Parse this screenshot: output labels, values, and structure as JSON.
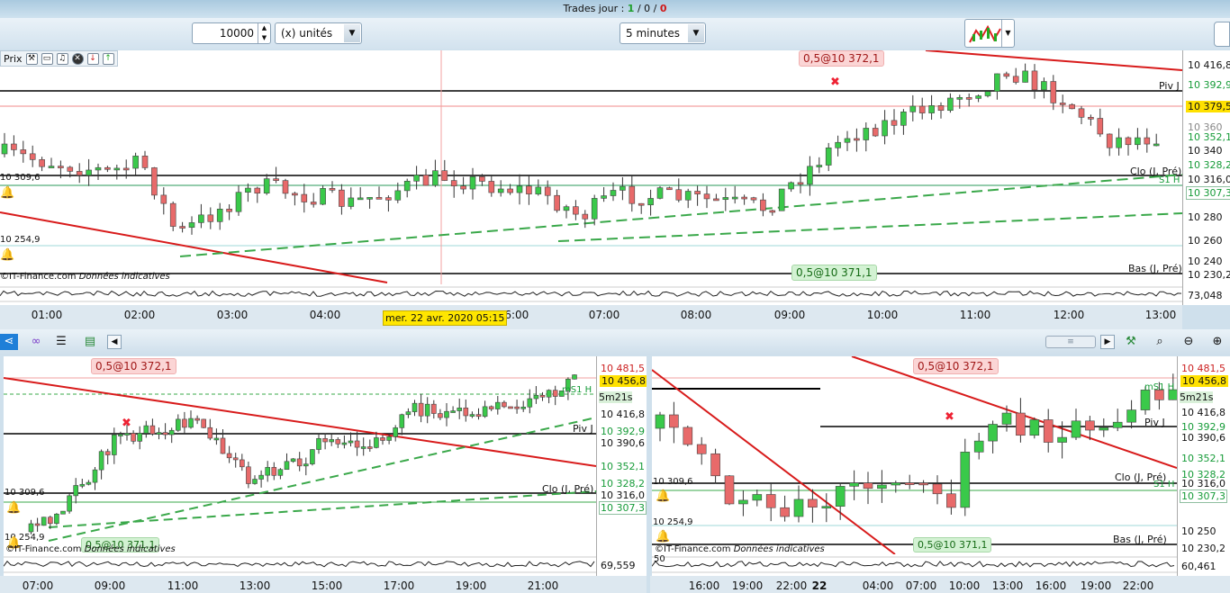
{
  "topbar": {
    "label": "Trades jour : ",
    "won": "1",
    "sep1": " / ",
    "neutral": "0",
    "sep2": " / ",
    "lost": "0"
  },
  "controls": {
    "quantity": "10000",
    "unit_select": "(x) unités",
    "period_select": "5 minutes"
  },
  "main_chart": {
    "legend": "Prix",
    "price_levels": [
      {
        "v": "10 416,8"
      },
      {
        "v": "10 392,9"
      },
      {
        "v": "10 379,5"
      },
      {
        "v": "10 360"
      },
      {
        "v": "10 352,1"
      },
      {
        "v": "10 340"
      },
      {
        "v": "10 328,2"
      },
      {
        "v": "10 316,0"
      },
      {
        "v": "10 307,3"
      },
      {
        "v": "10 280"
      },
      {
        "v": "10 260"
      },
      {
        "v": "10 240"
      },
      {
        "v": "10 230,2"
      }
    ],
    "indicator_value": "73,048",
    "line_labels": {
      "piv": "Piv J",
      "clo": "Clo (J, Pré)",
      "s1": "S1 H",
      "bas": "Bas (J, Pré)"
    },
    "left_values": {
      "a": "10 309,6",
      "b": "10 254,9"
    },
    "order_tag_top": "0,5@10 372,1",
    "order_tag_bottom": "0,5@10 371,1",
    "footer_src": "©IT-Finance.com",
    "footer_note": "Données indicatives",
    "cursor_date": "mer. 22 avr. 2020 05:15",
    "times": [
      "01:00",
      "02:00",
      "03:00",
      "04:00",
      "06:00",
      "07:00",
      "08:00",
      "09:00",
      "10:00",
      "11:00",
      "12:00",
      "13:00"
    ]
  },
  "left_chart": {
    "order_tag_top": "0,5@10 372,1",
    "order_tag_bottom": "0,5@10 371,1",
    "price_levels": [
      "10 481,5",
      "10 456,8",
      "10 416,8",
      "10 392,9",
      "10 390,6",
      "10 352,1",
      "10 328,2",
      "10 316,0",
      "10 307,3"
    ],
    "countdown": "5m21s",
    "labels": {
      "ms1": "mS1 H",
      "piv": "Piv J",
      "clo": "Clo (J, Pré)"
    },
    "left_values": {
      "a": "10 309,6",
      "b": "10 254,9"
    },
    "indicator_value": "69,559",
    "footer_src": "©IT-Finance.com",
    "footer_note": "Données indicatives",
    "times": [
      "07:00",
      "09:00",
      "11:00",
      "13:00",
      "15:00",
      "17:00",
      "19:00",
      "21:00"
    ]
  },
  "right_chart": {
    "order_tag_top": "0,5@10 372,1",
    "order_tag_bottom": "0,5@10 371,1",
    "price_levels": [
      "10 481,5",
      "10 456,8",
      "10 416,8",
      "10 392,9",
      "10 390,6",
      "10 352,1",
      "10 328,2",
      "10 316,0",
      "10 307,3",
      "10 250",
      "10 230,2"
    ],
    "countdown": "5m21s",
    "labels": {
      "ms1": "mS1 H",
      "piv": "Piv J",
      "clo": "Clo (J, Pré)",
      "s1": "S1 H",
      "bas": "Bas (J, Pré)"
    },
    "left_values": {
      "a": "10 309,6",
      "b": "10 254,9"
    },
    "indicator_value": "60,461",
    "indicator_left": "50",
    "footer_src": "©IT-Finance.com",
    "footer_note": "Données indicatives",
    "times": [
      "16:00",
      "19:00",
      "22:00",
      "22",
      "04:00",
      "07:00",
      "10:00",
      "13:00",
      "16:00",
      "19:00",
      "22:00"
    ]
  },
  "colors": {
    "up": "#3ac94a",
    "down": "#e86a6a",
    "trend": "#d81b1b",
    "dashed": "#3aa84a"
  }
}
